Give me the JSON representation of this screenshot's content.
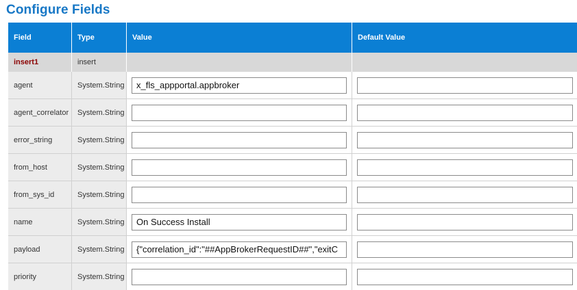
{
  "page": {
    "title": "Configure Fields"
  },
  "table": {
    "headers": {
      "field": "Field",
      "type": "Type",
      "value": "Value",
      "default_value": "Default Value"
    },
    "group": {
      "name": "insert1",
      "type": "insert"
    },
    "rows": [
      {
        "field": "agent",
        "type": "System.String",
        "value": "x_fls_appportal.appbroker",
        "default_value": ""
      },
      {
        "field": "agent_correlator",
        "type": "System.String",
        "value": "",
        "default_value": ""
      },
      {
        "field": "error_string",
        "type": "System.String",
        "value": "",
        "default_value": ""
      },
      {
        "field": "from_host",
        "type": "System.String",
        "value": "",
        "default_value": ""
      },
      {
        "field": "from_sys_id",
        "type": "System.String",
        "value": "",
        "default_value": ""
      },
      {
        "field": "name",
        "type": "System.String",
        "value": "On Success Install",
        "default_value": ""
      },
      {
        "field": "payload",
        "type": "System.String",
        "value": "{\"correlation_id\":\"##AppBrokerRequestID##\",\"exitC",
        "default_value": ""
      },
      {
        "field": "priority",
        "type": "System.String",
        "value": "",
        "default_value": ""
      }
    ]
  },
  "colors": {
    "title": "#1878c6",
    "header_bg": "#0b7fd4",
    "group_bg": "#d8d8d8",
    "group_name": "#8b0000",
    "label_bg": "#ececec"
  }
}
